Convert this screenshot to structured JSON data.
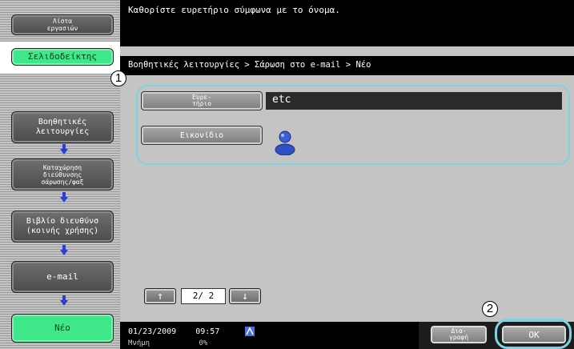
{
  "sidebar": {
    "job_list_label": "Λίστα\nεργασιών",
    "bookmark_label": "Σελιδοδείκτης",
    "steps": [
      "Βοηθητικές\nλειτουργίες",
      "Καταχώρηση\nδιεύθυνσης\nσάρωσης/φαξ",
      "Βιβλίο διευθύνσ\n(κοινής χρήσης)",
      "e-mail",
      "Νέο"
    ]
  },
  "main": {
    "message": "Καθορίστε ευρετήριο σύμφωνα με το όνομα.",
    "breadcrumb": "Βοηθητικές λειτουργίες > Σάρωση στο e-mail > Νέο",
    "index_button_label": "Ευρε-\nτήριο",
    "index_value": "etc",
    "icon_button_label": "Εικονίδιο",
    "icon_image": "user-icon",
    "pager": {
      "up_label": "↑",
      "page_text": "2/ 2",
      "down_label": "↓"
    }
  },
  "status": {
    "date": "01/23/2009",
    "time": "09:57",
    "memory_label": "Μνήμη",
    "memory_value": "0%"
  },
  "footer": {
    "delete_label": "Δια-\nγραφή",
    "ok_label": "OK"
  },
  "callouts": {
    "one": "1",
    "two": "2"
  },
  "colors": {
    "accent_green": "#3ee88a",
    "highlight": "#7ed2e6"
  }
}
